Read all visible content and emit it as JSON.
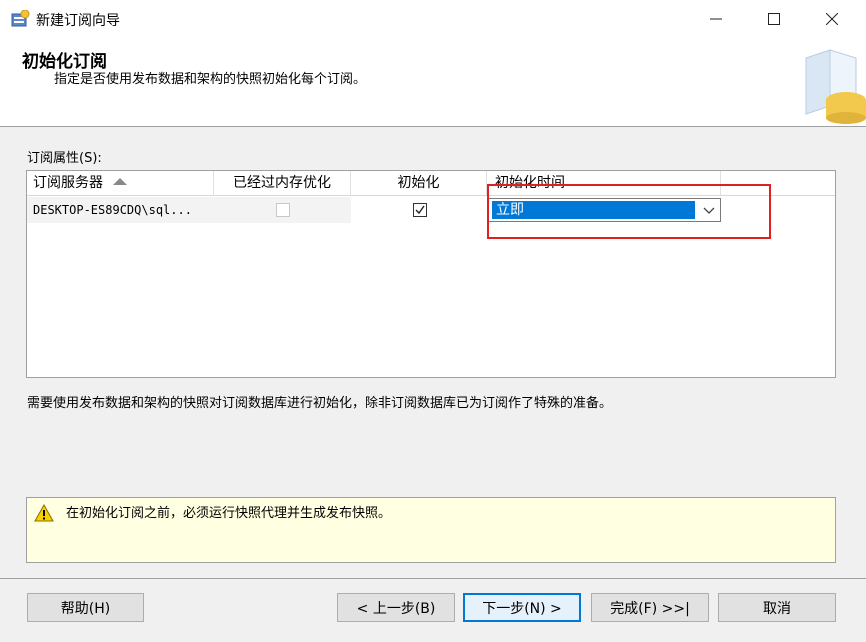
{
  "window": {
    "title": "新建订阅向导",
    "controls": [
      "minimize-icon",
      "maximize-icon",
      "close-icon"
    ]
  },
  "header": {
    "title": "初始化订阅",
    "subtitle": "指定是否使用发布数据和架构的快照初始化每个订阅。"
  },
  "grid": {
    "label": "订阅属性(S):",
    "columns": [
      "订阅服务器",
      "已经过内存优化",
      "初始化",
      "初始化时间"
    ],
    "sort_column": "订阅服务器",
    "rows": [
      {
        "server": "DESKTOP-ES89CDQ\\sql...",
        "memory_optimized": false,
        "initialize": true,
        "init_time": "立即"
      }
    ]
  },
  "note": "需要使用发布数据和架构的快照对订阅数据库进行初始化，除非订阅数据库已为订阅作了特殊的准备。",
  "warning": {
    "icon": "warning-icon",
    "text": "在初始化订阅之前，必须运行快照代理并生成发布快照。"
  },
  "buttons": {
    "help": "帮助(H)",
    "back": "< 上一步(B)",
    "next": "下一步(N) >",
    "finish": "完成(F) >>|",
    "cancel": "取消"
  },
  "colors": {
    "accent": "#0078d7",
    "highlight_border": "#e02020",
    "warning_bg": "#ffffe1"
  }
}
